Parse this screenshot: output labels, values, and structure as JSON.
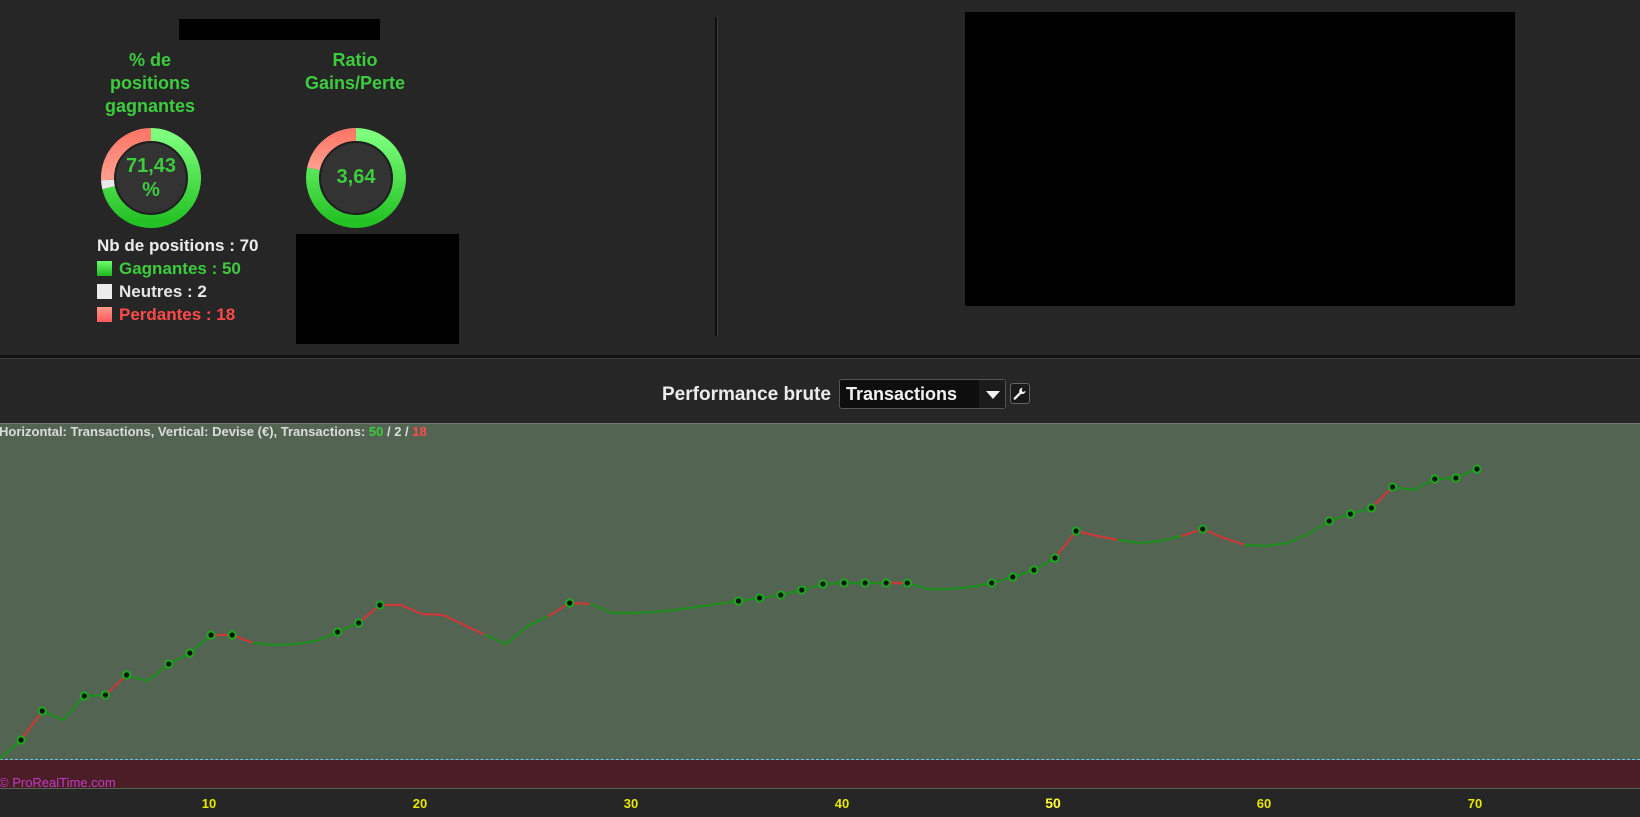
{
  "gauges": [
    {
      "title_lines": [
        "% de",
        "positions",
        "gagnantes"
      ],
      "value_lines": [
        "71,43",
        "%"
      ],
      "fraction": 0.7143,
      "neutral_fraction": 0.0286
    },
    {
      "title_lines": [
        "Ratio",
        "Gains/Perte"
      ],
      "value_lines": [
        "3,64"
      ],
      "fraction": 0.784,
      "neutral_fraction": 0
    }
  ],
  "positions": {
    "total_label": "Nb de positions : 70",
    "winning_label": "Gagnantes : 50",
    "neutral_label": "Neutres : 2",
    "losing_label": "Perdantes : 18"
  },
  "colors": {
    "win": "#34d634",
    "neutral": "#e9e9e9",
    "loss": "#ff6d6d",
    "accent": "#3dcc3d",
    "chart_bg": "#536453",
    "chart_bottom": "#4a1d27",
    "tick": "#e8e800"
  },
  "performance": {
    "label": "Performance brute",
    "select_value": "Transactions",
    "wrench_icon": "wrench-icon"
  },
  "chart_info": {
    "prefix": "Horizontal: Transactions, Vertical: Devise (€), Transactions: ",
    "wins": "50",
    "sep1": " / ",
    "neutrals": "2",
    "sep2": " / ",
    "losses": "18"
  },
  "copyright": "© ProRealTime.com",
  "chart_data": {
    "type": "line",
    "xlim": [
      0,
      77.5
    ],
    "y_baseline": 0,
    "x_ticks": [
      10,
      20,
      30,
      40,
      50,
      60,
      70
    ],
    "highlight_tick": 50,
    "points": [
      [
        0,
        0.4,
        "w",
        0
      ],
      [
        1,
        19,
        "w",
        1
      ],
      [
        2,
        48,
        "l",
        1
      ],
      [
        3,
        39,
        "w",
        0
      ],
      [
        4,
        63,
        "w",
        1
      ],
      [
        5,
        64,
        "w",
        1
      ],
      [
        6,
        84,
        "l",
        1
      ],
      [
        7,
        78,
        "w",
        0
      ],
      [
        8,
        95,
        "w",
        1
      ],
      [
        9,
        106,
        "w",
        1
      ],
      [
        10,
        124,
        "w",
        1
      ],
      [
        11,
        124,
        "l",
        1
      ],
      [
        12,
        116,
        "l",
        0
      ],
      [
        13,
        114,
        "w",
        0
      ],
      [
        14,
        115,
        "w",
        0
      ],
      [
        15,
        118,
        "w",
        0
      ],
      [
        16,
        127,
        "w",
        1
      ],
      [
        17,
        136,
        "w",
        1
      ],
      [
        18,
        154,
        "l",
        1
      ],
      [
        19,
        154,
        "l",
        0
      ],
      [
        20,
        145,
        "l",
        0
      ],
      [
        21,
        144,
        "l",
        0
      ],
      [
        22,
        134,
        "l",
        0
      ],
      [
        23,
        124,
        "l",
        0
      ],
      [
        24,
        115,
        "w",
        0
      ],
      [
        25,
        133,
        "w",
        0
      ],
      [
        26,
        143,
        "w",
        0
      ],
      [
        27,
        156,
        "l",
        1
      ],
      [
        28,
        155,
        "l",
        0
      ],
      [
        29,
        146,
        "w",
        0
      ],
      [
        30,
        146,
        "w",
        0
      ],
      [
        31,
        147,
        "w",
        0
      ],
      [
        32,
        149,
        "w",
        0
      ],
      [
        33,
        152,
        "w",
        0
      ],
      [
        34,
        155,
        "w",
        0
      ],
      [
        35,
        158,
        "w",
        1
      ],
      [
        36,
        161,
        "w",
        1
      ],
      [
        37,
        164,
        "w",
        1
      ],
      [
        38,
        169,
        "w",
        1
      ],
      [
        39,
        175,
        "w",
        1
      ],
      [
        40,
        176,
        "w",
        1
      ],
      [
        41,
        176,
        "w",
        1
      ],
      [
        42,
        176,
        "w",
        1
      ],
      [
        43,
        176,
        "l",
        1
      ],
      [
        44,
        170,
        "w",
        0
      ],
      [
        45,
        170,
        "w",
        0
      ],
      [
        46,
        172,
        "w",
        0
      ],
      [
        47,
        176,
        "w",
        1
      ],
      [
        48,
        182,
        "w",
        1
      ],
      [
        49,
        189,
        "w",
        1
      ],
      [
        50,
        201,
        "w",
        1
      ],
      [
        51,
        228,
        "l",
        1
      ],
      [
        52,
        223,
        "l",
        0
      ],
      [
        53,
        219,
        "l",
        0
      ],
      [
        54,
        216,
        "w",
        0
      ],
      [
        55,
        218,
        "w",
        0
      ],
      [
        56,
        223,
        "w",
        0
      ],
      [
        57,
        230,
        "l",
        1
      ],
      [
        58,
        221,
        "l",
        0
      ],
      [
        59,
        214,
        "l",
        0
      ],
      [
        60,
        213,
        "w",
        0
      ],
      [
        61,
        216,
        "w",
        0
      ],
      [
        62,
        225,
        "w",
        0
      ],
      [
        63,
        238,
        "w",
        1
      ],
      [
        64,
        245,
        "w",
        1
      ],
      [
        65,
        251,
        "w",
        1
      ],
      [
        66,
        272,
        "l",
        1
      ],
      [
        67,
        269,
        "w",
        0
      ],
      [
        68,
        280,
        "w",
        1
      ],
      [
        69,
        281,
        "w",
        1
      ],
      [
        70,
        290,
        "w",
        1
      ]
    ],
    "ylim": [
      -28,
      337
    ]
  }
}
